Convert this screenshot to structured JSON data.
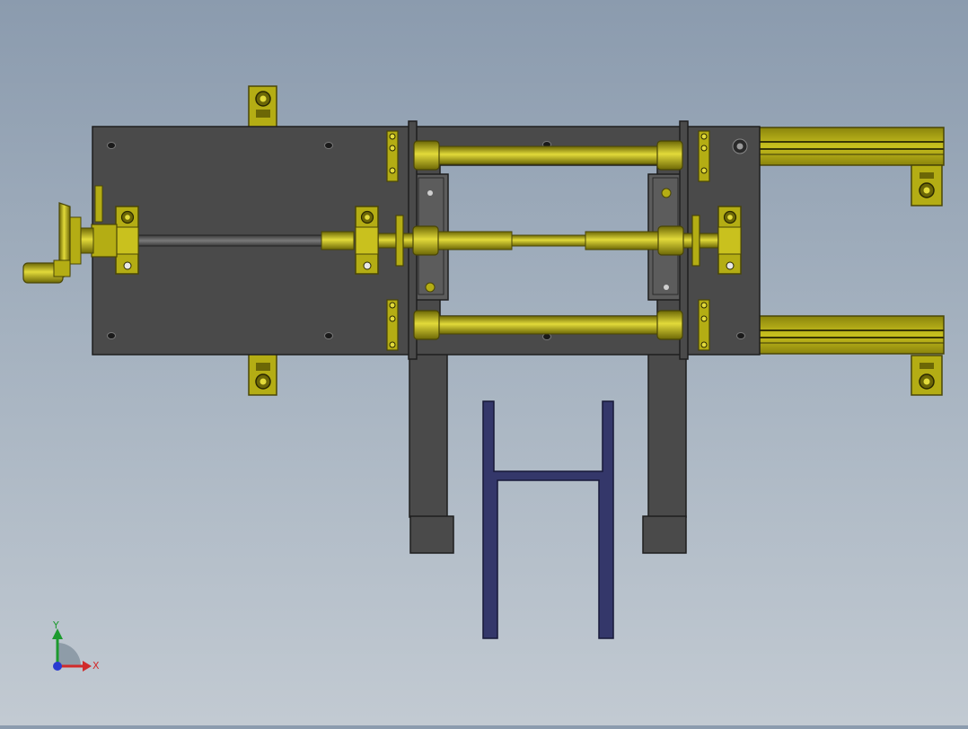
{
  "viewport": {
    "background_top": "#8b9bae",
    "background_bottom": "#c2cad2"
  },
  "colors": {
    "plate": "#4a4a4a",
    "plate_edge": "#1e1e1e",
    "brass": "#b4ad14",
    "brass_light": "#e2da3a",
    "brass_dark": "#6c6706",
    "steel": "#575757",
    "frame": "#34376a",
    "frame_edge": "#161838",
    "axis_x": "#d12a2a",
    "axis_y": "#1c9a2e",
    "axis_z": "#2a3ad1"
  },
  "triad": {
    "x_label": "X",
    "y_label": "Y",
    "icons": [
      "axis-triad-icon"
    ]
  }
}
